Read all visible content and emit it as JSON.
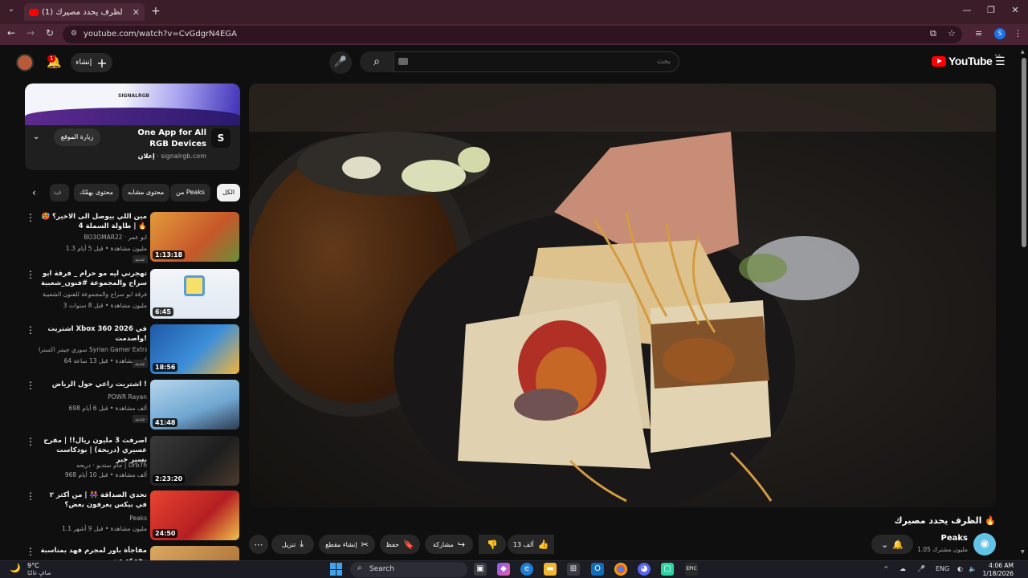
{
  "browser": {
    "tab_title": "(1) الظرف يحدد مصيرك 🔥",
    "url": "youtube.com/watch?v=CvGdgrN4EGA"
  },
  "header": {
    "notification_count": "1",
    "create_label": "إنشاء",
    "search_placeholder": "بحث",
    "logo_text": "YouTube",
    "logo_region": "SA"
  },
  "ad": {
    "banner_brand": "SIGNALRGB",
    "title": "One App for All RGB Devices",
    "sponsored_label": "إعلان",
    "domain": "signalrgb.com",
    "visit_label": "زيارة الموقع"
  },
  "chips": {
    "all": "الكل",
    "from_channel": "من Peaks",
    "similar": "محتوى مشابه",
    "for_you": "محتوى يهمّك",
    "more": "فيد"
  },
  "recommendations": [
    {
      "title": "مين اللي بيوصل الى الاخير؟ 🥵 🔥 | طاولة السملة 4",
      "channel": "BO3OMAR22 · ابو عمر",
      "meta": "1.3 مليون مشاهدة • قبل 5 أيام",
      "badge": "جديد",
      "duration": "1:13:18",
      "thumb_color": "#c6572a"
    },
    {
      "title": "تهجرني ليه مو حرام _ فرقة ابو سراج والمجموعة #فنون_شعبية",
      "channel": "فرقة ابو سراج والمجموعة للفنون الشعبية",
      "meta": "3 مليون مشاهدة • قبل 8 سنوات",
      "badge": "",
      "duration": "6:45",
      "thumb_color": "#e9eef4"
    },
    {
      "title": "اشتريت Xbox 360 في 2026 واصدمت!",
      "channel": "سوري جيمر اكسترا Syrian Gamer Extra",
      "meta": "64 ألف مشاهدة • قبل 13 ساعة",
      "badge": "جديد",
      "duration": "18:56",
      "thumb_color": "#2a6db5"
    },
    {
      "title": "اشتريت راعي حول الرياض !",
      "channel": "POWR Rayan",
      "meta": "698 ألف مشاهدة • قبل 6 أيام",
      "badge": "جديد",
      "duration": "41:48",
      "thumb_color": "#7fb3d8"
    },
    {
      "title": "اصرفت 3 مليون ريال!! | مفرح عسيري (دريحة) | بودكاست بسير خير",
      "channel": "جام ستديو · دريحه | Drb7h",
      "meta": "968 ألف مشاهدة • قبل 10 أيام",
      "badge": "",
      "duration": "2:23:20",
      "thumb_color": "#2b2b2b"
    },
    {
      "title": "تحدي الصداقة 👭 | من أكثر ٢ في بيكس يعرفون بعض؟",
      "channel": "Peaks",
      "meta": "1.1 مليون مشاهدة • قبل 9 أشهر",
      "badge": "",
      "duration": "24:50",
      "thumb_color": "#d8322e"
    },
    {
      "title": "مفاجأة باور لمجرم فهد بمناسبة رجوعه من",
      "channel": "",
      "meta": "",
      "badge": "",
      "duration": "",
      "thumb_color": "#c89550"
    }
  ],
  "video": {
    "title": "الظرف يحدد مصيرك 🔥",
    "channel": "Peaks",
    "subscribers": "1.05 مليون مشترك",
    "likes": "13 ألف",
    "share_label": "مشاركة",
    "save_label": "حفظ",
    "clip_label": "إنشاء مقطع",
    "download_label": "تنزيل"
  },
  "taskbar": {
    "temperature": "9°C",
    "weather": "صافٍ غالبًا",
    "search_label": "Search",
    "language": "ENG",
    "time": "4:06 AM",
    "date": "1/18/2026"
  },
  "colors": {
    "yt_red": "#ff0000",
    "browser_tab_bg": "#3b1d2a",
    "page_bg": "#0f0f0f"
  }
}
